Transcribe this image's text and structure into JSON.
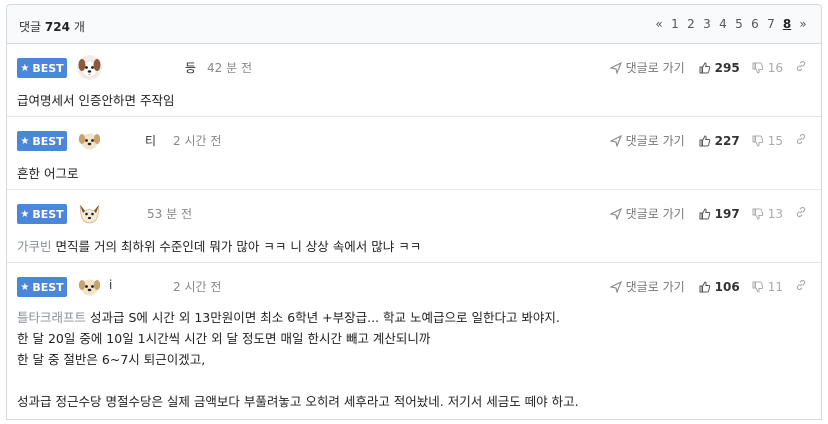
{
  "header": {
    "count_prefix": "댓글",
    "count_value": "724",
    "count_suffix": "개",
    "pager": {
      "first": "«",
      "pages": [
        "1",
        "2",
        "3",
        "4",
        "5",
        "6",
        "7",
        "8"
      ],
      "current": "8",
      "last": "»"
    }
  },
  "comments": [
    {
      "badge": "BEST",
      "nickname": "등",
      "time": "42 분 전",
      "reply_label": "댓글로 가기",
      "likes": "295",
      "dislikes": "16",
      "text": "급여명세서 인증안하면 주작임",
      "lines": []
    },
    {
      "badge": "BEST",
      "nickname": "티",
      "time": "2 시간 전",
      "reply_label": "댓글로 가기",
      "likes": "227",
      "dislikes": "15",
      "text": "흔한 어그로",
      "lines": []
    },
    {
      "badge": "BEST",
      "nickname": "",
      "time": "53 분 전",
      "reply_label": "댓글로 가기",
      "likes": "197",
      "dislikes": "13",
      "tag": "가쿠빈",
      "text": "면직를 거의 최하위 수준인데 뭐가 많아 ㅋㅋ 니 상상 속에서 많냐 ㅋㅋ",
      "lines": []
    },
    {
      "badge": "BEST",
      "nickname": "i",
      "time": "2 시간 전",
      "reply_label": "댓글로 가기",
      "likes": "106",
      "dislikes": "11",
      "tag": "틀타크래프트",
      "text": "성과급 S에 시간 외 13만원이면 최소 6학년 +부장급... 학교 노예급으로 일한다고 봐야지.",
      "lines": [
        "한 달 20일 중에 10일 1시간씩 시간 외 달 정도면 매일 한시간 빼고 계산되니까",
        "한 달 중 절반은 6~7시 퇴근이겠고,",
        "",
        "성과급 정근수당 명절수당은 실제 금액보다 부풀려놓고 오히려 세후라고 적어놨네. 저기서 세금도 떼야 하고."
      ]
    }
  ],
  "colors": {
    "best_badge": "#4a86d9",
    "border": "#d5d8dc",
    "tag_text": "#8a9099"
  },
  "icons": {
    "reply": "send-arrow-icon",
    "like": "thumbs-up-icon",
    "dislike": "thumbs-down-icon",
    "link": "link-icon",
    "badge": "star-icon"
  }
}
